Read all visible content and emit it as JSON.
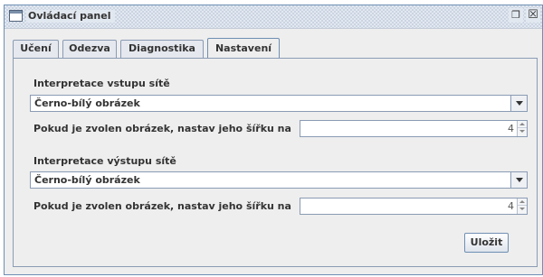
{
  "window": {
    "title": "Ovládací panel",
    "maximize_icon": "maximize-icon",
    "close_icon": "close-icon"
  },
  "tabs": [
    {
      "label": "Učení",
      "active": false
    },
    {
      "label": "Odezva",
      "active": false
    },
    {
      "label": "Diagnostika",
      "active": false
    },
    {
      "label": "Nastavení",
      "active": true
    }
  ],
  "input_section": {
    "label": "Interpretace vstupu sítě",
    "combo_value": "Černo-bílý obrázek",
    "width_label": "Pokud je zvolen obrázek, nastav jeho šířku na",
    "width_value": "4"
  },
  "output_section": {
    "label": "Interpretace výstupu sítě",
    "combo_value": "Černo-bílý obrázek",
    "width_label": "Pokud je zvolen obrázek, nastav jeho šířku na",
    "width_value": "4"
  },
  "save_button": "Uložit",
  "colors": {
    "border_accent": "#6f8fb3",
    "panel_bg": "#eeeeee"
  }
}
